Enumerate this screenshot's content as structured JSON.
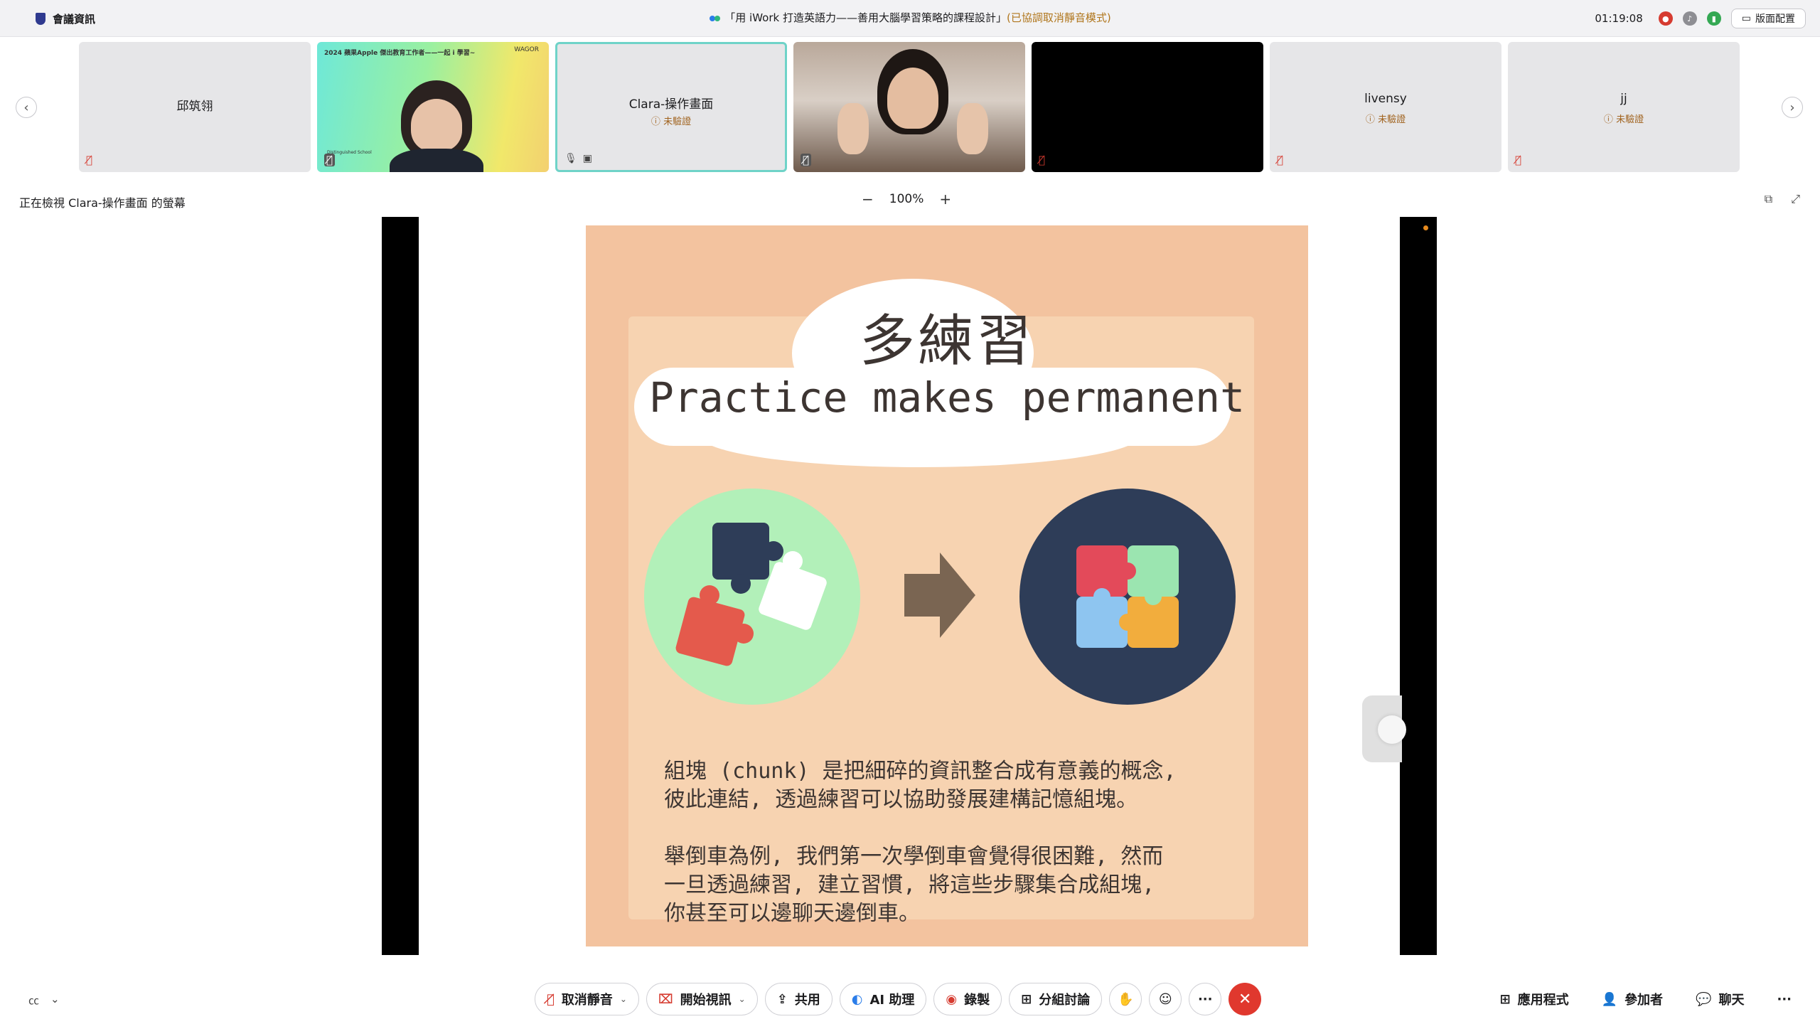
{
  "topbar": {
    "meeting_info_label": "會議資訊",
    "meeting_title": "「用 iWork 打造英語力——善用大腦學習策略的課程設計」",
    "meeting_status": "(已協調取消靜音模式)",
    "timer": "01:19:08",
    "layout_label": "版面配置"
  },
  "participants": [
    {
      "name": "邱筑翎",
      "sub": ""
    },
    {
      "name": "",
      "sub": "",
      "banner": "2024 蘋果Apple 傑出教育工作者——一起 i 學習~",
      "logo": "WAGOR",
      "caption": "Distinguished School"
    },
    {
      "name": "Clara-操作畫面",
      "sub": "未驗證"
    },
    {
      "name": "",
      "sub": ""
    },
    {
      "name": "",
      "sub": ""
    },
    {
      "name": "livensy",
      "sub": "未驗證"
    },
    {
      "name": "jj",
      "sub": "未驗證"
    }
  ],
  "share": {
    "viewing_label": "正在檢視 Clara-操作畫面 的螢幕",
    "zoom_level": "100%",
    "zoom_out": "−",
    "zoom_in": "+"
  },
  "slide": {
    "title_zh": "多練習",
    "title_en": "Practice makes permanent",
    "body": "組塊 (chunk) 是把細碎的資訊整合成有意義的概念,\n彼此連結, 透過練習可以協助發展建構記憶組塊。\n\n舉倒車為例, 我們第一次學倒車會覺得很困難, 然而\n一旦透過練習, 建立習慣, 將這些步驟集合成組塊,\n你甚至可以邊聊天邊倒車。"
  },
  "toolbar": {
    "unmute_label": "取消靜音",
    "start_video_label": "開始視訊",
    "share_label": "共用",
    "ai_label": "AI 助理",
    "record_label": "錄製",
    "breakout_label": "分組討論",
    "more_label": "···",
    "apps_label": "應用程式",
    "participants_label": "參加者",
    "chat_label": "聊天",
    "overflow_label": "···"
  },
  "colors": {
    "accent_teal": "#6fd3c8",
    "end_red": "#e0382e",
    "slide_bg": "#f3c39f",
    "slide_text": "#3d3532"
  }
}
